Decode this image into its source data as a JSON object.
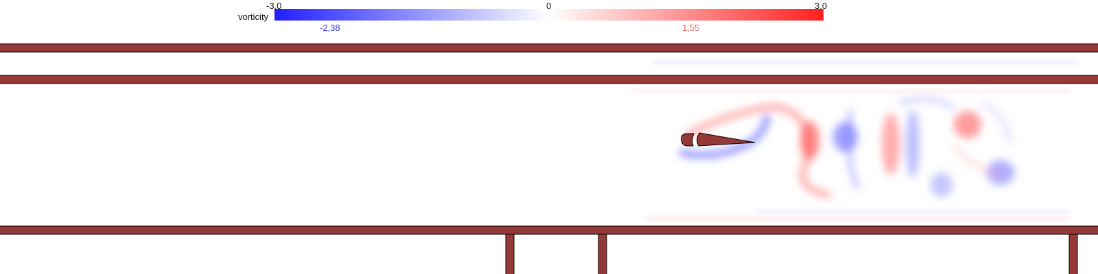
{
  "colorbar": {
    "title": "vorticity",
    "min_label": "-3,0",
    "mid_label": "0",
    "max_label": "3,0",
    "min_value": -3.0,
    "max_value": 3.0,
    "negative_color": "#1f1fff",
    "positive_color": "#ff1f1f",
    "readout_min": "-2,38",
    "readout_max": "1,55",
    "readout_min_value": -2.38,
    "readout_max_value": 1.55,
    "readout_min_color": "#3a3aee",
    "readout_max_color": "#f06a6a"
  },
  "scene": {
    "solid_color": "#953838",
    "outline_color": "#000000",
    "background": "#ffffff"
  }
}
